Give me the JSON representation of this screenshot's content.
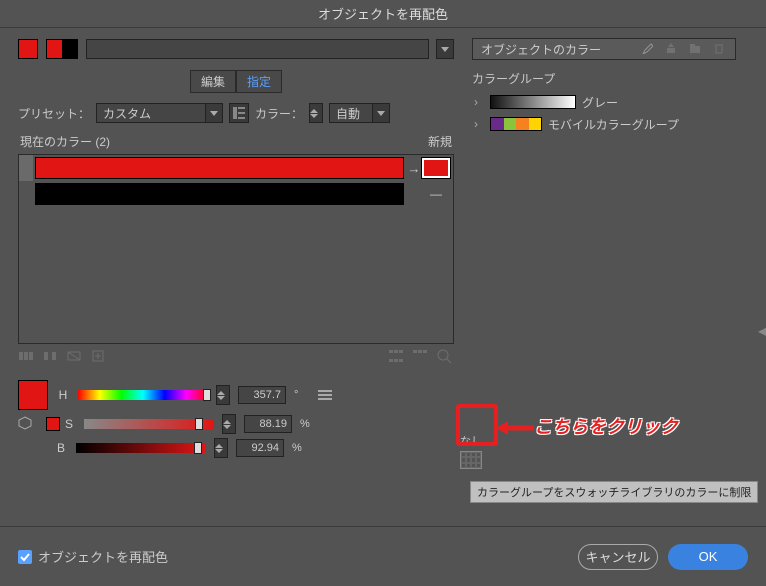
{
  "title": "オブジェクトを再配色",
  "tabs": {
    "edit": "編集",
    "assign": "指定"
  },
  "preset": {
    "label": "プリセット：",
    "value": "カスタム",
    "color_label": "カラー：",
    "color_value": "自動"
  },
  "current": {
    "header": "現在のカラー (2)",
    "count": 2,
    "new_label": "新規"
  },
  "hsb": {
    "h_label": "H",
    "s_label": "S",
    "b_label": "B",
    "h_value": "357.7",
    "h_unit": "°",
    "s_value": "88.19",
    "s_unit": "%",
    "b_value": "92.94",
    "b_unit": "%"
  },
  "right": {
    "artwork_label": "オブジェクトのカラー",
    "group_header": "カラーグループ",
    "groups": [
      {
        "name": "グレー"
      },
      {
        "name": "モバイルカラーグループ"
      }
    ]
  },
  "none": {
    "label": "なし",
    "tooltip": "カラーグループをスウォッチライブラリのカラーに制限"
  },
  "annotation": {
    "text": "こちらをクリック"
  },
  "footer": {
    "checkbox_label": "オブジェクトを再配色",
    "cancel": "キャンセル",
    "ok": "OK"
  }
}
